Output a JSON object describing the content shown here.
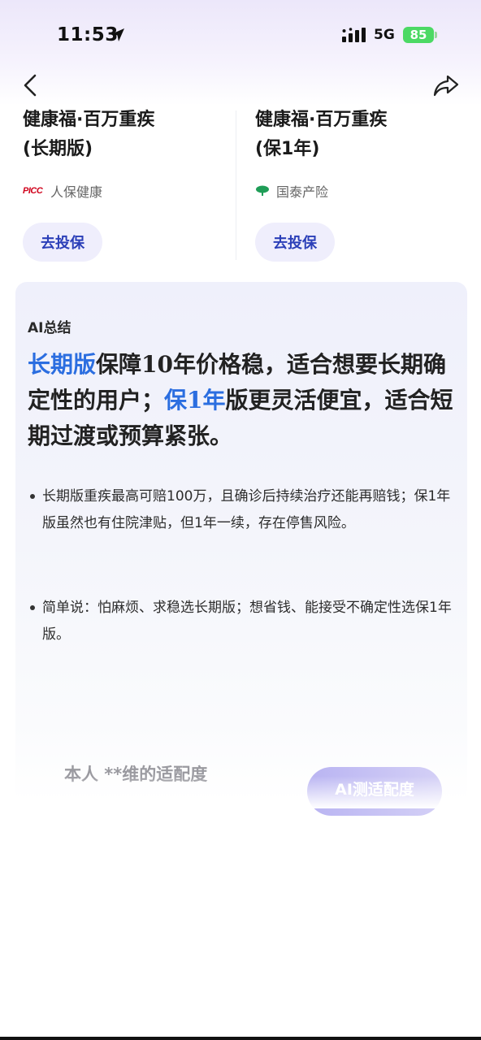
{
  "status_bar": {
    "time": "11:53",
    "network": "5G",
    "battery": "85"
  },
  "nav": {
    "back_icon": "chevron-left-icon",
    "share_icon": "share-arrow-icon"
  },
  "products": [
    {
      "title_line1": "健康福·百万重疾",
      "title_line2": "(长期版)",
      "insurer_logo_text": "PICC",
      "insurer": "人保健康",
      "cta": "去投保"
    },
    {
      "title_line1": "健康福·百万重疾",
      "title_line2": "(保1年)",
      "insurer_logo": "tree-logo-icon",
      "insurer": "国泰产险",
      "cta": "去投保"
    }
  ],
  "ai_summary": {
    "label": "AI总结",
    "headline": {
      "hl1": "长期版",
      "part1": "保障10年价格稳，适合想要长期确定性的用户；",
      "hl2": "保1年",
      "part2": "版更灵活便宜，适合短期过渡或预算紧张。"
    },
    "bullets": [
      "长期版重疾最高可赔100万，且确诊后持续治疗还能再赔钱；保1年版虽然也有住院津贴，但1年一续，存在停售风险。",
      "简单说：怕麻烦、求稳选长期版；想省钱、能接受不确定性选保1年版。"
    ],
    "fit_text": "本人 **维的适配度",
    "fit_button": "AI测适配度"
  },
  "colors": {
    "highlight": "#2b6ee0",
    "cta_text": "#2b3fb8",
    "cta_bg": "#efeefc",
    "battery": "#4cd964"
  }
}
